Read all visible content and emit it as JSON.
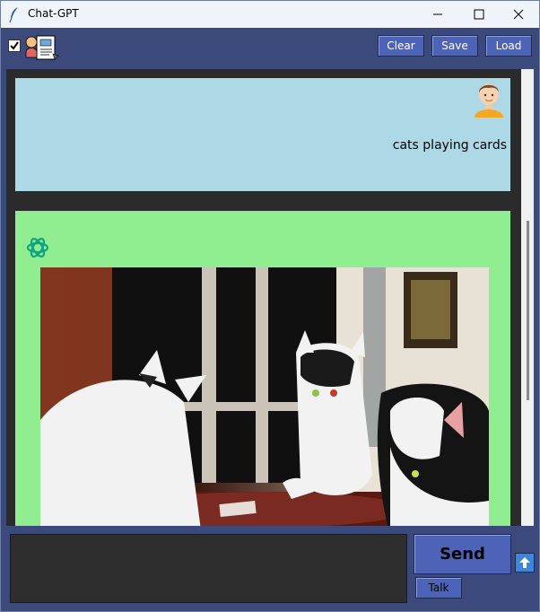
{
  "window": {
    "title": "Chat-GPT"
  },
  "toolbar": {
    "checkbox_checked": true,
    "tool_icon": "speaker-document-icon",
    "clear_label": "Clear",
    "save_label": "Save",
    "load_label": "Load"
  },
  "messages": [
    {
      "role": "user",
      "avatar_icon": "user-avatar-icon",
      "text": "cats playing cards",
      "background": "#add8e6"
    },
    {
      "role": "assistant",
      "avatar_icon": "openai-logo-icon",
      "image_subject": "photo-cats-at-table",
      "background": "#90ee90"
    }
  ],
  "input": {
    "value": "",
    "placeholder": ""
  },
  "actions": {
    "send_label": "Send",
    "talk_label": "Talk",
    "up_icon": "arrow-up-icon"
  },
  "colors": {
    "app_bg": "#3b4a7a",
    "button": "#4d63b8",
    "chat_bg": "#2b2b2b"
  }
}
